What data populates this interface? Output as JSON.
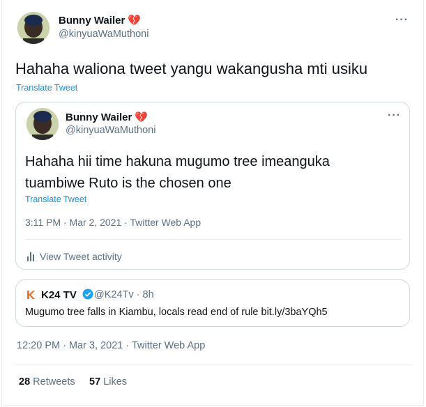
{
  "tweet": {
    "author_name": "Bunny Wailer",
    "author_emoji": "💔",
    "author_handle": "@kinyuaWaMuthoni",
    "text": "Hahaha waliona tweet yangu wakangusha mti usiku",
    "translate_label": "Translate Tweet",
    "more_label": "···",
    "timestamp": "12:20 PM · Mar 3, 2021 · Twitter Web App",
    "retweets_count": "28",
    "retweets_label": "Retweets",
    "likes_count": "57",
    "likes_label": "Likes"
  },
  "quoted": {
    "author_name": "Bunny Wailer",
    "author_emoji": "💔",
    "author_handle": "@kinyuaWaMuthoni",
    "text": "Hahaha hii time hakuna mugumo tree imeanguka tuambiwe Ruto is the chosen one",
    "translate_label": "Translate Tweet",
    "more_label": "···",
    "timestamp": "3:11 PM · Mar 2, 2021 · Twitter Web App",
    "activity_label": "View Tweet activity"
  },
  "nested_quote": {
    "author_name": "K24 TV",
    "author_handle": "@K24Tv · 8h",
    "text": "Mugumo tree falls in Kiambu, locals read end of rule bit.ly/3baYQh5"
  },
  "colors": {
    "link": "#1b95e0",
    "muted": "#5b7083",
    "heart": "#e0245e",
    "verified": "#1da1f2"
  }
}
